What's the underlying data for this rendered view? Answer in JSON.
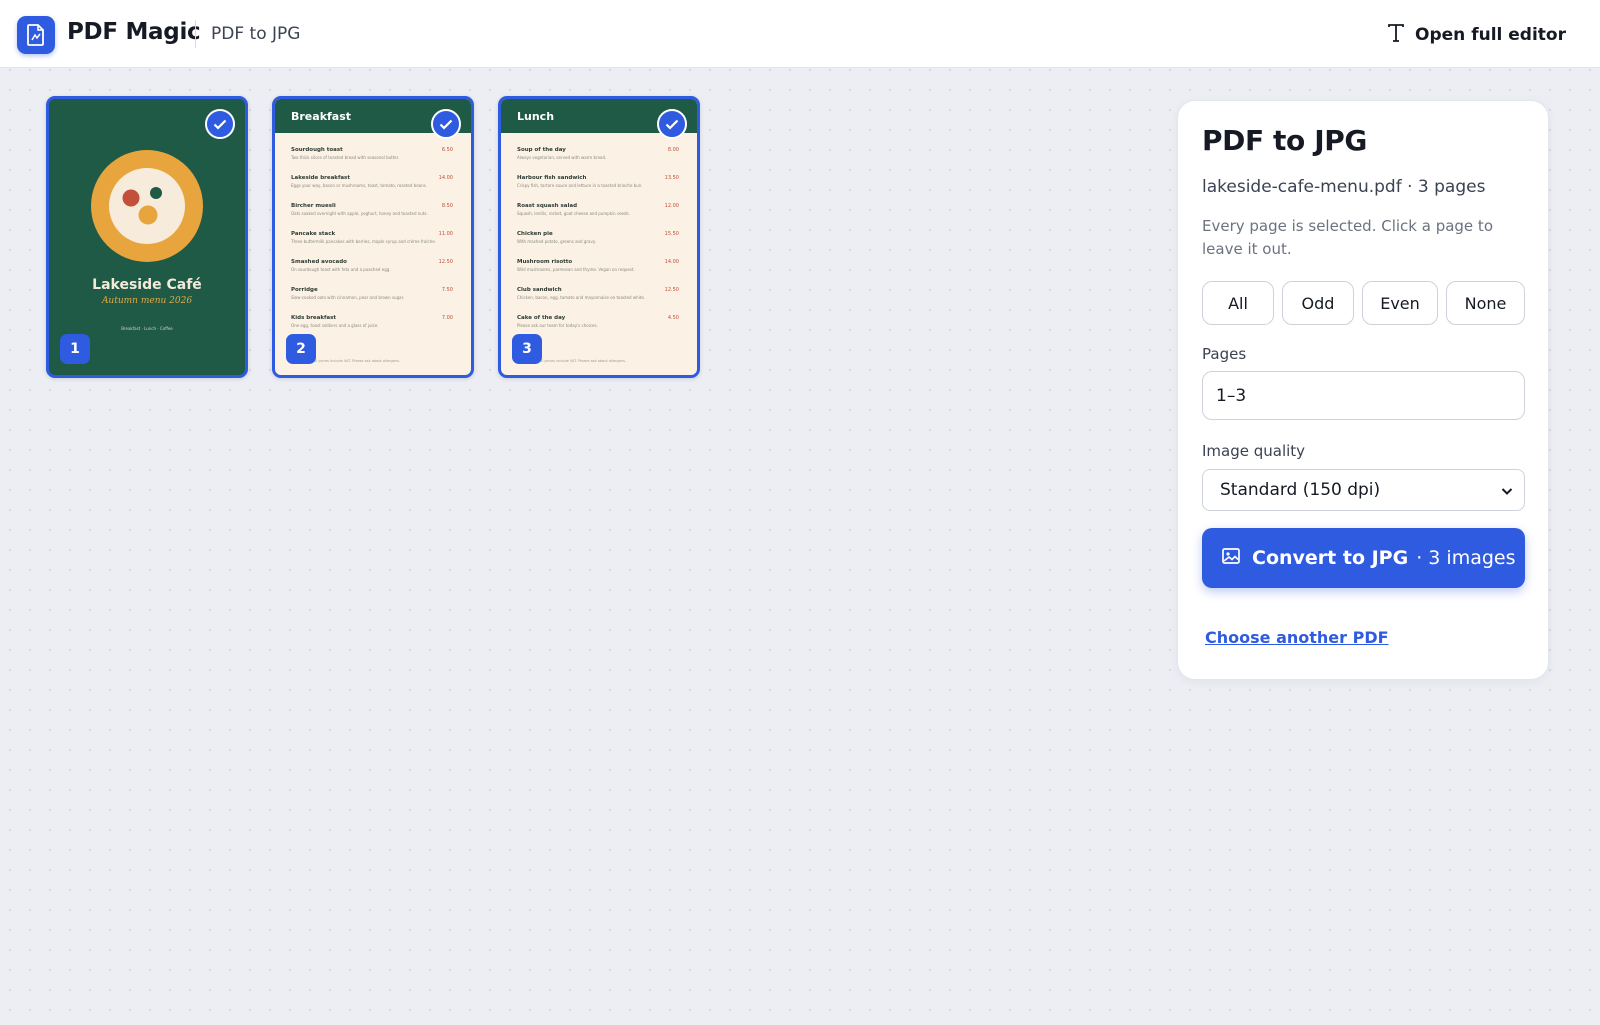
{
  "header": {
    "brand": "PDF Magic",
    "tool": "PDF to JPG",
    "open_editor_label": "Open full editor"
  },
  "pages": [
    {
      "number": "1",
      "selected": true,
      "cover_title": "Lakeside Café",
      "cover_subtitle": "Autumn menu 2026",
      "cover_footer": "Breakfast · Lunch · Coffee"
    },
    {
      "number": "2",
      "selected": true,
      "heading": "Breakfast",
      "items": [
        {
          "name": "Sourdough toast",
          "price": "6.50",
          "desc": "Two thick slices of toasted bread with seasonal butter."
        },
        {
          "name": "Lakeside breakfast",
          "price": "14.00",
          "desc": "Eggs your way, bacon or mushrooms, toast, tomato, roasted beans."
        },
        {
          "name": "Bircher muesli",
          "price": "8.50",
          "desc": "Oats soaked overnight with apple, yoghurt, honey and toasted nuts."
        },
        {
          "name": "Pancake stack",
          "price": "11.00",
          "desc": "Three buttermilk pancakes with berries, maple syrup and crème fraîche."
        },
        {
          "name": "Smashed avocado",
          "price": "12.50",
          "desc": "On sourdough toast with feta and a poached egg."
        },
        {
          "name": "Porridge",
          "price": "7.50",
          "desc": "Slow-cooked oats with cinnamon, pear and brown sugar."
        },
        {
          "name": "Kids breakfast",
          "price": "7.00",
          "desc": "One egg, toast soldiers and a glass of juice."
        }
      ],
      "footer": "All prices include VAT. Please ask about allergens."
    },
    {
      "number": "3",
      "selected": true,
      "heading": "Lunch",
      "items": [
        {
          "name": "Soup of the day",
          "price": "8.00",
          "desc": "Always vegetarian, served with warm bread."
        },
        {
          "name": "Harbour fish sandwich",
          "price": "13.50",
          "desc": "Crispy fish, tartare sauce and lettuce in a toasted brioche bun."
        },
        {
          "name": "Roast squash salad",
          "price": "12.00",
          "desc": "Squash, lentils, rocket, goat cheese and pumpkin seeds."
        },
        {
          "name": "Chicken pie",
          "price": "15.50",
          "desc": "With mashed potato, greens and gravy."
        },
        {
          "name": "Mushroom risotto",
          "price": "14.00",
          "desc": "Wild mushrooms, parmesan and thyme. Vegan on request."
        },
        {
          "name": "Club sandwich",
          "price": "12.50",
          "desc": "Chicken, bacon, egg, tomato and mayonnaise on toasted white."
        },
        {
          "name": "Cake of the day",
          "price": "4.50",
          "desc": "Please ask our team for today's choices."
        }
      ],
      "footer": "All prices include VAT. Please ask about allergens."
    }
  ],
  "panel": {
    "title": "PDF to JPG",
    "file_info": "lakeside-cafe-menu.pdf · 3 pages",
    "hint": "Every page is selected. Click a page to leave it out.",
    "quick_select": [
      "All",
      "Odd",
      "Even",
      "None"
    ],
    "pages_label": "Pages",
    "pages_value": "1–3",
    "quality_label": "Image quality",
    "quality_value": "Standard (150 dpi)",
    "convert_label": "Convert to JPG",
    "convert_count": "· 3 images",
    "another_label": "Choose another PDF"
  },
  "colors": {
    "accent": "#2f5be0",
    "cover_green": "#1f5a46",
    "cover_orange": "#e8a53e",
    "menu_paper": "#fbf1e4"
  },
  "icons": {
    "logo": "pdf-file-icon",
    "editor": "text-t-icon",
    "selected": "checkmark-icon",
    "convert": "image-icon",
    "dropdown": "chevron-down-icon"
  }
}
